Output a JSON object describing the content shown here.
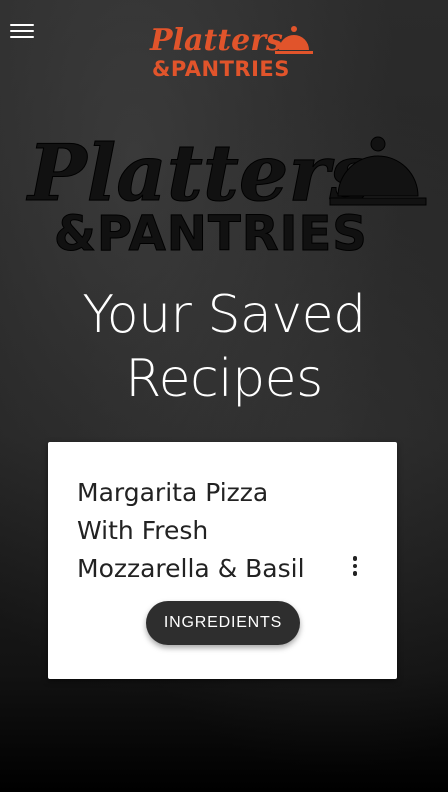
{
  "app": {
    "name": "Platters & Pantries"
  },
  "header": {
    "logo_line1": "Platters",
    "logo_line2": "&PANTRIES"
  },
  "hero": {
    "logo_line1": "Platters",
    "logo_line2": "&PANTRIES"
  },
  "page": {
    "title_line1": "Your Saved",
    "title_line2": "Recipes"
  },
  "recipes": [
    {
      "title": "Margarita Pizza With Fresh Mozzarella & Basil",
      "button_label": "INGREDIENTS"
    }
  ],
  "colors": {
    "brand": "#e1542b",
    "card_bg": "#ffffff",
    "button_bg": "#2e2e2e"
  },
  "icons": {
    "menu": "hamburger-icon",
    "logo": "cloche-icon",
    "more": "more-vert-icon"
  }
}
